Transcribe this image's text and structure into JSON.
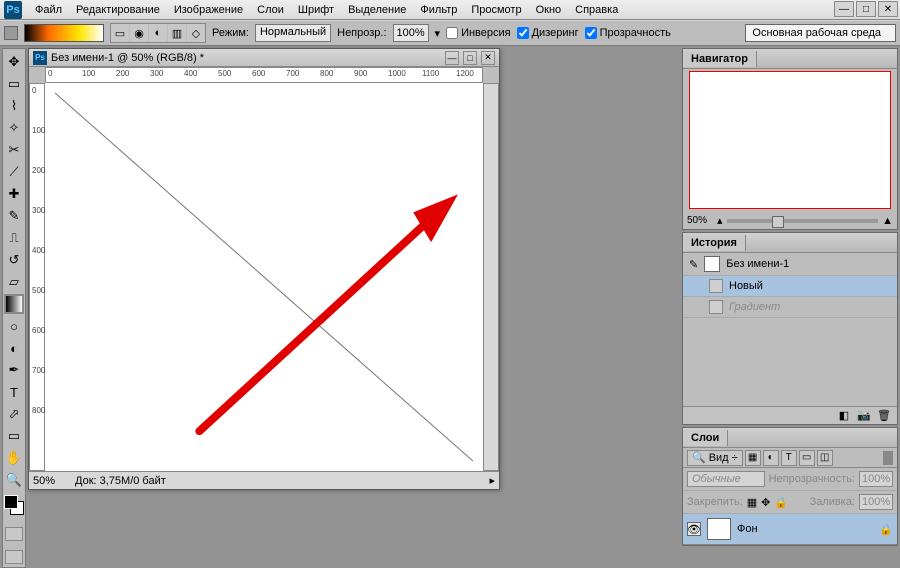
{
  "menu": {
    "logo": "Ps",
    "items": [
      "Файл",
      "Редактирование",
      "Изображение",
      "Слои",
      "Шрифт",
      "Выделение",
      "Фильтр",
      "Просмотр",
      "Окно",
      "Справка"
    ]
  },
  "winctrl": {
    "min": "—",
    "max": "□",
    "close": "✕"
  },
  "options": {
    "mode_label": "Режим:",
    "mode_value": "Нормальный",
    "opacity_label": "Непрозр.:",
    "opacity_value": "100%",
    "invert": "Инверсия",
    "dither": "Дизеринг",
    "transp": "Прозрачность",
    "workspace": "Основная рабочая среда"
  },
  "doc": {
    "title": "Без имени-1 @ 50% (RGB/8) *",
    "zoom": "50%",
    "status": "Док: 3,75M/0 байт",
    "ruler_h": [
      "0",
      "100",
      "200",
      "300",
      "400",
      "500",
      "600",
      "700",
      "800",
      "900",
      "1000",
      "1100",
      "1200"
    ],
    "ruler_v": [
      "0",
      "100",
      "200",
      "300",
      "400",
      "500",
      "600",
      "700",
      "800"
    ]
  },
  "panels": {
    "nav": {
      "title": "Навигатор",
      "zoom": "50%"
    },
    "hist": {
      "title": "История",
      "doc": "Без имени-1",
      "items": [
        {
          "label": "Новый"
        },
        {
          "label": "Градиент"
        }
      ]
    },
    "layers": {
      "title": "Слои",
      "kind": "Вид",
      "mix": "Обычные",
      "opacity_label": "Непрозрачность:",
      "opacity_value": "100%",
      "lock_label": "Закрепить:",
      "fill_label": "Заливка:",
      "fill_value": "100%",
      "bg_name": "Фон"
    }
  }
}
